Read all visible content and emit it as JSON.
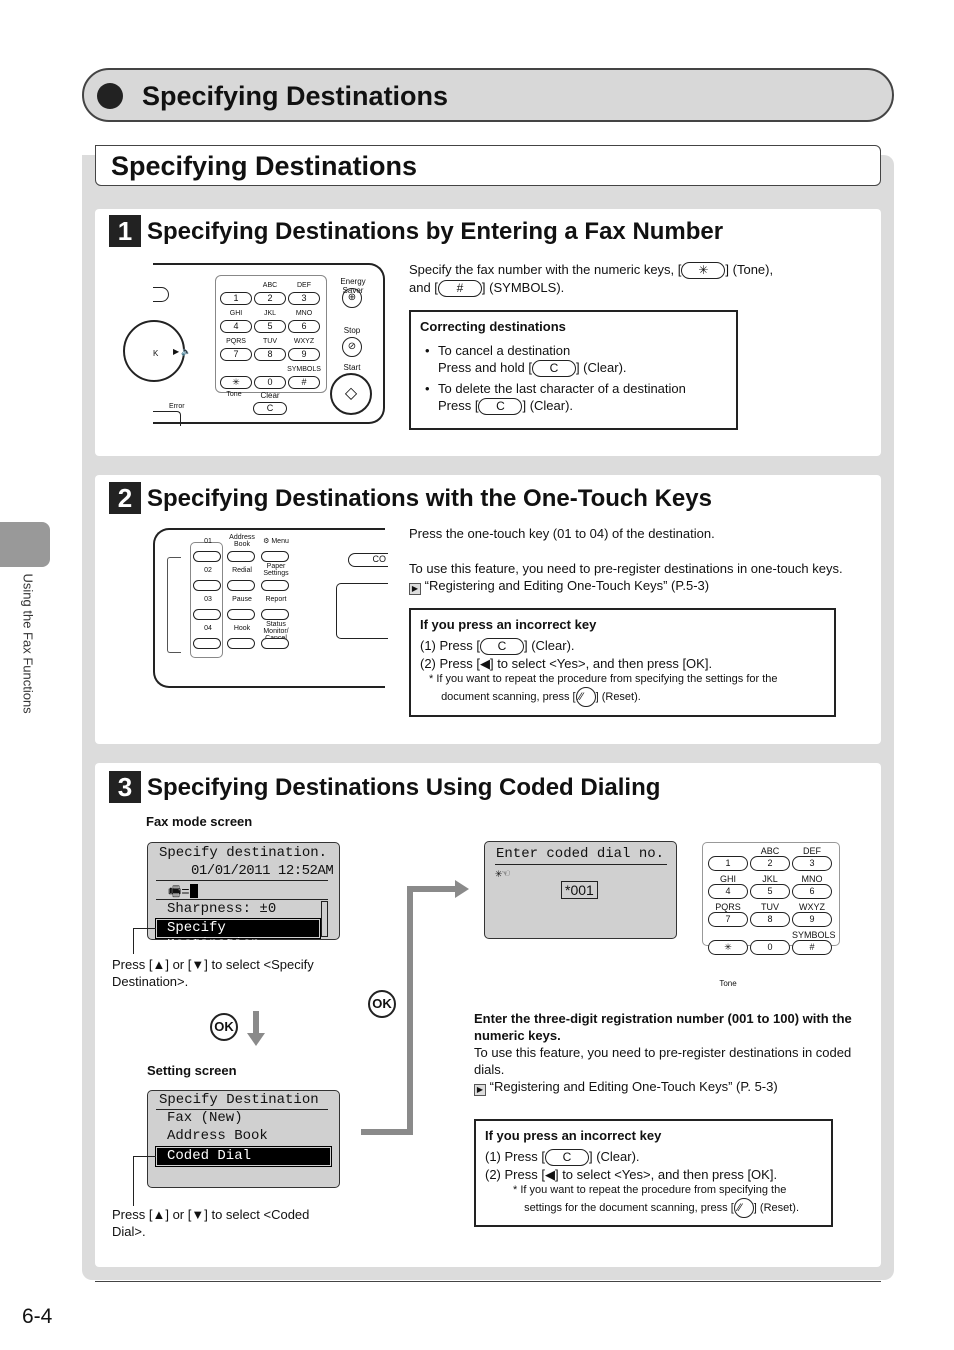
{
  "chapter_title": "Specifying Destinations",
  "section_title": "Specifying Destinations",
  "side_tab": "Using the Fax Functions",
  "page_number": "6-4",
  "keys": {
    "star": "✳",
    "hash": "#",
    "clear": "C",
    "reset": "⁄⁄",
    "ok": "OK",
    "left": "◀",
    "up": "▲",
    "down": "▼"
  },
  "s1": {
    "num": "1",
    "title": "Specifying Destinations by Entering a Fax Number",
    "desc_a": "Specify the fax number with the numeric keys, [",
    "desc_b": "] (Tone),",
    "desc_c": "and [",
    "desc_d": "] (SYMBOLS).",
    "box_title": "Correcting destinations",
    "b1": "To cancel a destination",
    "b1b": "Press and hold [",
    "b1c": "] (Clear).",
    "b2": "To delete the last character of a destination",
    "b2b": "Press [",
    "b2c": "] (Clear).",
    "panel": {
      "letters": [
        "",
        "ABC",
        "DEF",
        "GHI",
        "JKL",
        "MNO",
        "PQRS",
        "TUV",
        "WXYZ",
        "",
        "",
        "SYMBOLS"
      ],
      "digits": [
        "1",
        "2",
        "3",
        "4",
        "5",
        "6",
        "7",
        "8",
        "9",
        "✳",
        "0",
        "#"
      ],
      "energy": "Energy Saver",
      "stop": "Stop",
      "start": "Start",
      "tone": "Tone",
      "clear": "Clear",
      "clear_key": "C",
      "error": "Error",
      "ok": "K"
    }
  },
  "s2": {
    "num": "2",
    "title": "Specifying Destinations with the One-Touch Keys",
    "p1": "Press the one-touch key (01 to 04) of the destination.",
    "p2": "To use this feature, you need to pre-register destinations in one-touch keys.",
    "p3": "“Registering and Editing One-Touch Keys” (P.5-3)",
    "box_title": "If you press an incorrect key",
    "l1a": "(1) Press [",
    "l1b": "] (Clear).",
    "l2a": "(2) Press [",
    "l2b": "] to select <Yes>, and then press [OK].",
    "note_a": "* If you want to repeat the procedure from specifying the settings for the",
    "note_b": "document scanning, press [",
    "note_c": "] (Reset).",
    "panel": {
      "onetouch": [
        "01",
        "02",
        "03",
        "04"
      ],
      "col2": [
        "Address Book",
        "Redial",
        "Pause",
        "Hook"
      ],
      "col3": [
        "⚙ Menu",
        "Paper Settings",
        "Report",
        "Status Monitor/ Cancel"
      ],
      "co": "CO"
    }
  },
  "s3": {
    "num": "3",
    "title": "Specifying Destinations Using Coded Dialing",
    "fax_mode_label": "Fax mode screen",
    "lcd1": {
      "l1": "Specify destination.",
      "l2": "01/01/2011 12:52AM",
      "l3": "=",
      "l4": "Sharpness: ±0",
      "l5": "Specify Destination"
    },
    "cap1a": "Press [",
    "cap1b": "] or [",
    "cap1c": "] to select <Specify",
    "cap1d": "Destination>.",
    "setting_label": "Setting screen",
    "lcd2": {
      "l1": "Specify Destination",
      "l2": "Fax (New)",
      "l3": "Address Book",
      "l4": "Coded Dial"
    },
    "cap2a": "Press [",
    "cap2b": "] or [",
    "cap2c": "] to select <Coded",
    "cap2d": "Dial>.",
    "lcd3": {
      "l1": "Enter coded dial no.",
      "value": "*001"
    },
    "keypad": {
      "letters": [
        "",
        "ABC",
        "DEF",
        "GHI",
        "JKL",
        "MNO",
        "PQRS",
        "TUV",
        "WXYZ",
        "",
        "",
        "SYMBOLS"
      ],
      "digits": [
        "1",
        "2",
        "3",
        "4",
        "5",
        "6",
        "7",
        "8",
        "9",
        "✳",
        "0",
        "#"
      ],
      "tone": "Tone"
    },
    "instr_bold": "Enter the three-digit registration number (001 to 100) with the numeric keys.",
    "instr": "To use this feature, you need to pre-register destinations in coded dials.",
    "ref": "“Registering and Editing One-Touch Keys” (P. 5-3)",
    "box_title": "If you press an incorrect key",
    "l1a": "(1) Press [",
    "l1b": "] (Clear).",
    "l2a": "(2) Press [",
    "l2b": "] to select <Yes>, and then press [OK].",
    "note_a": "* If you want to repeat the procedure from specifying the",
    "note_b": "settings for the document scanning, press [",
    "note_c": "] (Reset)."
  }
}
